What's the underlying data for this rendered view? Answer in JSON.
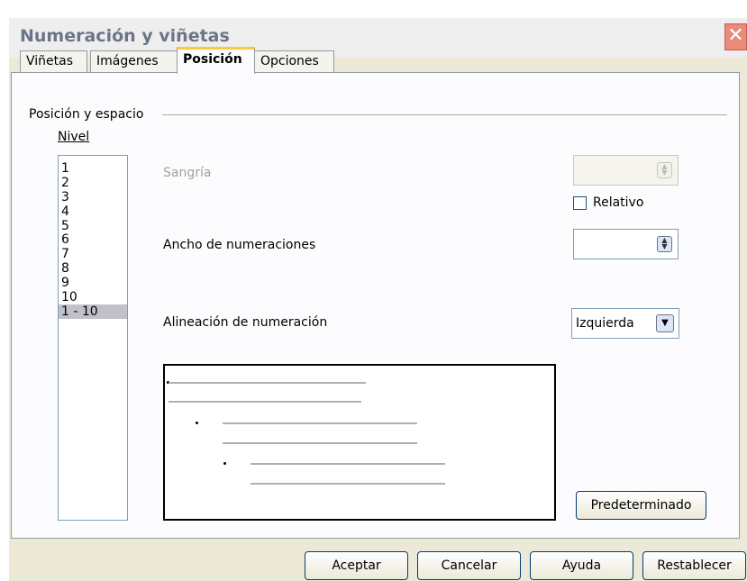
{
  "window": {
    "title": "Numeración y viñetas",
    "close_symbol": "✕"
  },
  "tabs": [
    {
      "label": "Viñetas",
      "active": false
    },
    {
      "label": "Imágenes",
      "active": false
    },
    {
      "label": "Posición",
      "active": true
    },
    {
      "label": "Opciones",
      "active": false
    }
  ],
  "section": {
    "legend": "Posición y espacio"
  },
  "level": {
    "label": "Nivel",
    "items": [
      "1",
      "2",
      "3",
      "4",
      "5",
      "6",
      "7",
      "8",
      "9",
      "10",
      "1 - 10"
    ],
    "selected": "1 - 10"
  },
  "fields": {
    "indent_label": "Sangría",
    "relative_label": "Relativo",
    "width_label": "Ancho de numeraciones",
    "align_label": "Alineación de numeración",
    "align_value": "Izquierda"
  },
  "icons": {
    "spin_up": "▲",
    "spin_down": "▼",
    "dropdown": "▼"
  },
  "buttons": {
    "default": "Predeterminado",
    "ok": "Aceptar",
    "cancel": "Cancelar",
    "help": "Ayuda",
    "reset": "Restablecer"
  }
}
